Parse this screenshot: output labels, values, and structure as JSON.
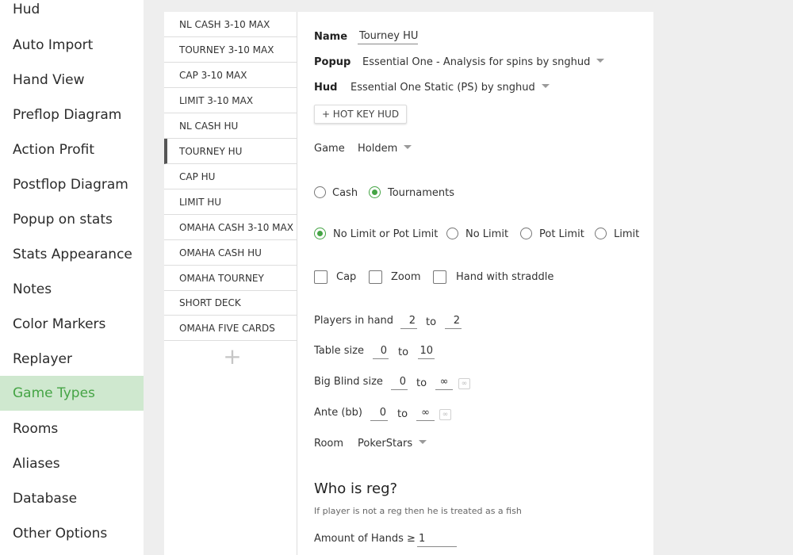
{
  "nav": {
    "items": [
      {
        "label": "Hud"
      },
      {
        "label": "Auto Import"
      },
      {
        "label": "Hand View"
      },
      {
        "label": "Preflop Diagram"
      },
      {
        "label": "Action Profit"
      },
      {
        "label": "Postflop Diagram"
      },
      {
        "label": "Popup on stats"
      },
      {
        "label": "Stats Appearance"
      },
      {
        "label": "Notes"
      },
      {
        "label": "Color Markers"
      },
      {
        "label": "Replayer"
      },
      {
        "label": "Game Types"
      },
      {
        "label": "Rooms"
      },
      {
        "label": "Aliases"
      },
      {
        "label": "Database"
      },
      {
        "label": "Other Options"
      }
    ],
    "active": "Game Types",
    "accent": "#45a445"
  },
  "game_types": {
    "items": [
      "NL CASH 3-10 MAX",
      "TOURNEY 3-10 MAX",
      "CAP 3-10 MAX",
      "LIMIT 3-10 MAX",
      "NL CASH HU",
      "TOURNEY HU",
      "CAP HU",
      "LIMIT HU",
      "OMAHA CASH 3-10 MAX",
      "OMAHA CASH HU",
      "OMAHA TOURNEY",
      "SHORT DECK",
      "OMAHA FIVE CARDS"
    ],
    "selected": "TOURNEY HU",
    "add_icon": "+"
  },
  "form": {
    "name_label": "Name",
    "name_value": "Tourney HU",
    "popup_label": "Popup",
    "popup_value": "Essential One - Analysis for spins by snghud",
    "hud_label": "Hud",
    "hud_value": "Essential One Static (PS) by snghud",
    "hotkey_button": "+ HOT KEY HUD",
    "game_label": "Game",
    "game_value": "Holdem",
    "type_options": [
      {
        "label": "Cash",
        "selected": false
      },
      {
        "label": "Tournaments",
        "selected": true
      }
    ],
    "limit_options": [
      {
        "label": "No Limit or Pot Limit",
        "selected": true
      },
      {
        "label": "No Limit",
        "selected": false
      },
      {
        "label": "Pot Limit",
        "selected": false
      },
      {
        "label": "Limit",
        "selected": false
      }
    ],
    "checkboxes": [
      {
        "label": "Cap",
        "checked": false
      },
      {
        "label": "Zoom",
        "checked": false
      },
      {
        "label": "Hand with straddle",
        "checked": false
      }
    ],
    "players_label": "Players in hand",
    "players_from": "2",
    "players_to": "2",
    "table_size_label": "Table size",
    "table_from": "0",
    "table_to": "10",
    "bb_label": "Big Blind size",
    "bb_from": "0",
    "bb_to": "∞",
    "ante_label": "Ante (bb)",
    "ante_from": "0",
    "ante_to": "∞",
    "to_word": "to",
    "infinity_toggle": "∞",
    "room_label": "Room",
    "room_value": "PokerStars"
  },
  "reg": {
    "title": "Who is reg?",
    "hint": "If player is not a reg then he is treated as a fish",
    "hands_label": "Amount of Hands ≥",
    "hands_value": "1"
  }
}
